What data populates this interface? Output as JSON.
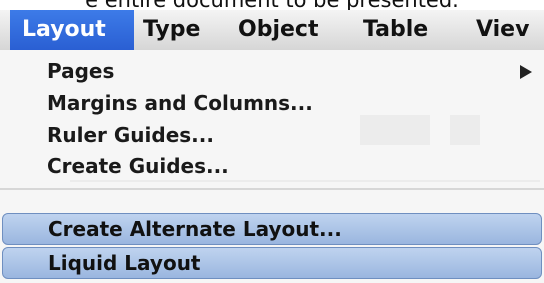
{
  "top_caption": "e entire document to be presented.",
  "menubar": {
    "items": [
      {
        "label": "Layout",
        "active": true
      },
      {
        "label": "Type",
        "active": false
      },
      {
        "label": "Object",
        "active": false
      },
      {
        "label": "Table",
        "active": false
      },
      {
        "label": "Viev",
        "active": false
      }
    ]
  },
  "menu": {
    "pages": "Pages",
    "margins_columns": "Margins and Columns...",
    "ruler_guides": "Ruler Guides...",
    "create_guides": "Create Guides...",
    "create_alternate_layout": "Create Alternate Layout...",
    "liquid_layout": "Liquid Layout"
  },
  "icons": {
    "submenu_arrow": "submenu-arrow-icon"
  },
  "colors": {
    "active_menu_bg": "#2a5fd3",
    "highlight_bg": "#9ab6df"
  }
}
